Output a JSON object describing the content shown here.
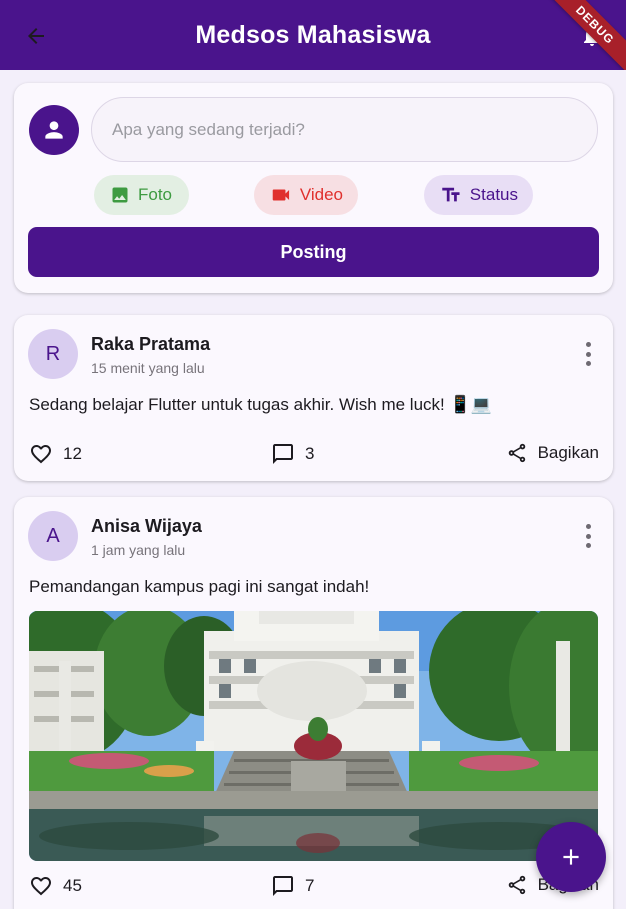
{
  "appbar": {
    "title": "Medsos Mahasiswa",
    "debug_label": "DEBUG",
    "back_icon": "arrow-left-icon",
    "notification_icon": "bell-icon"
  },
  "composer": {
    "placeholder": "Apa yang sedang terjadi?",
    "chips": {
      "foto": "Foto",
      "video": "Video",
      "status": "Status"
    },
    "post_label": "Posting"
  },
  "posts": [
    {
      "avatar_letter": "R",
      "name": "Raka Pratama",
      "time": "15 menit yang lalu",
      "text": "Sedang belajar Flutter untuk tugas akhir. Wish me luck! 📱💻",
      "likes": "12",
      "comments": "3",
      "share_label": "Bagikan"
    },
    {
      "avatar_letter": "A",
      "name": "Anisa Wijaya",
      "time": "1 jam yang lalu",
      "text": "Pemandangan kampus pagi ini sangat indah!",
      "likes": "45",
      "comments": "7",
      "share_label": "Bagikan"
    }
  ],
  "colors": {
    "primary": "#4a148c",
    "foto": "#3e9b41",
    "video": "#e0302d",
    "background": "#f3effa"
  }
}
